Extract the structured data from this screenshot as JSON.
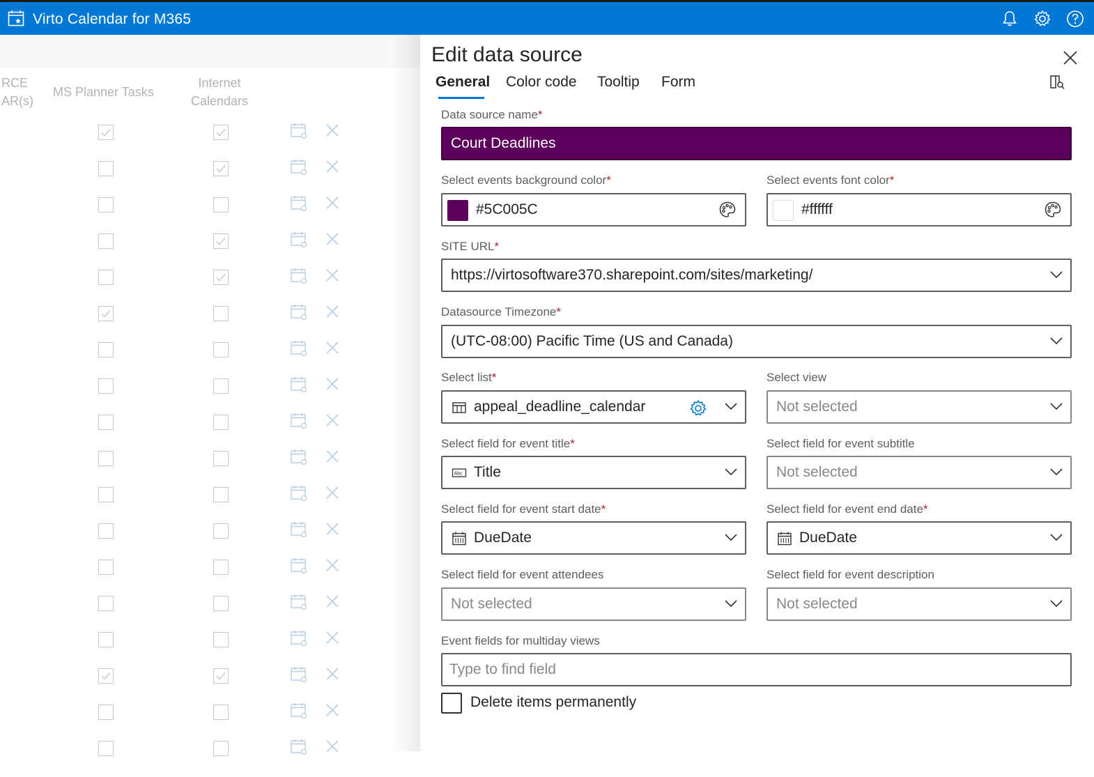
{
  "app": {
    "title": "Virto Calendar for M365"
  },
  "background_table": {
    "col_source_line1": "RCE",
    "col_source_line2": "AR(s)",
    "col_planner": "MS Planner Tasks",
    "col_internet_line1": "Internet",
    "col_internet_line2": "Calendars",
    "rows": [
      {
        "planner": true,
        "internet": true
      },
      {
        "planner": false,
        "internet": true
      },
      {
        "planner": false,
        "internet": false
      },
      {
        "planner": false,
        "internet": true
      },
      {
        "planner": false,
        "internet": true
      },
      {
        "planner": true,
        "internet": false
      },
      {
        "planner": false,
        "internet": false
      },
      {
        "planner": false,
        "internet": false
      },
      {
        "planner": false,
        "internet": false
      },
      {
        "planner": false,
        "internet": false
      },
      {
        "planner": false,
        "internet": false
      },
      {
        "planner": false,
        "internet": false
      },
      {
        "planner": false,
        "internet": false
      },
      {
        "planner": false,
        "internet": false
      },
      {
        "planner": false,
        "internet": false
      },
      {
        "planner": true,
        "internet": true
      },
      {
        "planner": false,
        "internet": false
      },
      {
        "planner": false,
        "internet": false
      }
    ]
  },
  "panel": {
    "title": "Edit data source",
    "tabs": [
      {
        "label": "General",
        "active": true
      },
      {
        "label": "Color code",
        "active": false
      },
      {
        "label": "Tooltip",
        "active": false
      },
      {
        "label": "Form",
        "active": false
      }
    ],
    "required_mark": "*",
    "data_source_name": {
      "label": "Data source name",
      "value": "Court Deadlines"
    },
    "bg_color": {
      "label": "Select events background color",
      "value": "#5C005C",
      "swatch": "#5c005c"
    },
    "font_color": {
      "label": "Select events font color",
      "value": "#ffffff",
      "swatch": "#ffffff"
    },
    "site_url": {
      "label": "SITE URL",
      "value": "https://virtosoftware370.sharepoint.com/sites/marketing/"
    },
    "timezone": {
      "label": "Datasource Timezone",
      "value": "(UTC-08:00) Pacific Time (US and Canada)"
    },
    "select_list": {
      "label": "Select list",
      "value": "appeal_deadline_calendar"
    },
    "select_view": {
      "label": "Select view",
      "value": "Not selected"
    },
    "event_title": {
      "label": "Select field for event title",
      "value": "Title"
    },
    "event_subtitle": {
      "label": "Select field for event subtitle",
      "value": "Not selected"
    },
    "event_start": {
      "label": "Select field for event start date",
      "value": "DueDate"
    },
    "event_end": {
      "label": "Select field for event end date",
      "value": "DueDate"
    },
    "event_attendees": {
      "label": "Select field for event attendees",
      "value": "Not selected"
    },
    "event_description": {
      "label": "Select field for event description",
      "value": "Not selected"
    },
    "multiday": {
      "label": "Event fields for multiday views",
      "placeholder": "Type to find field"
    },
    "delete_permanently": {
      "label": "Delete items permanently",
      "checked": false
    }
  },
  "colors": {
    "brand": "#0078d4",
    "event_bg": "#5C005C"
  }
}
